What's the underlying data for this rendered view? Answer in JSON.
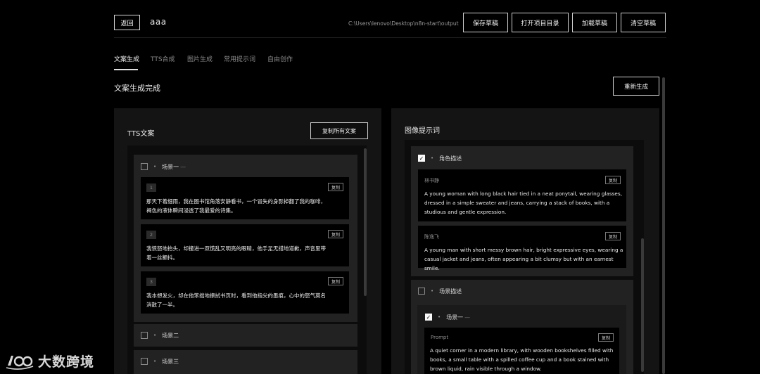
{
  "header": {
    "back_label": "返回",
    "project_name": "aaa",
    "output_path": "C:\\Users\\lenovo\\Desktop\\n8n-start\\output",
    "buttons": [
      "保存草稿",
      "打开项目目录",
      "加载草稿",
      "清空草稿"
    ]
  },
  "tabs": [
    "文案生成",
    "TTS合成",
    "图片生成",
    "常用提示词",
    "自由创作"
  ],
  "main": {
    "title": "文案生成完成",
    "regenerate_label": "重新生成"
  },
  "tts": {
    "title": "TTS文案",
    "copy_all_label": "复制所有文案",
    "scenes": [
      {
        "label": "场景一",
        "checked": false,
        "items": [
          {
            "num": "1",
            "copy_label": "复制",
            "lines": [
              "那天下着细雨，我在图书馆角落安静看书，一个冒失的身影掉翻了我的咖啡，",
              "褐色的液体瞬间浸透了我最爱的诗集。"
            ]
          },
          {
            "num": "2",
            "copy_label": "复制",
            "lines": [
              "我愤怒地抬头，却撞进一双慌乱又明亮的眼睛，他手足无措地道歉，声音里带",
              "着一丝颤抖。"
            ]
          },
          {
            "num": "3",
            "copy_label": "复制",
            "lines": [
              "我本想发火，却在他笨拙地擦拭书页时，看到他指尖的墨痕，心中的怒气莫名",
              "消散了一半。"
            ]
          }
        ]
      },
      {
        "label": "场景二",
        "checked": false
      },
      {
        "label": "场景三",
        "checked": false
      }
    ]
  },
  "image_prompts": {
    "title": "图像提示词",
    "character_section": {
      "label": "角色描述",
      "checked": true,
      "items": [
        {
          "name": "林书静",
          "copy_label": "复制",
          "lines": [
            "A young woman with long black hair tied in a neat ponytail, wearing glasses,",
            "dressed in a simple sweater and jeans, carrying a stack of books, with a",
            "studious and gentle expression."
          ]
        },
        {
          "name": "陈逸飞",
          "copy_label": "复制",
          "lines": [
            "A young man with short messy brown hair, bright expressive eyes, wearing a",
            "casual jacket and jeans, often appearing a bit clumsy but with an earnest smile."
          ]
        }
      ]
    },
    "scene_section": {
      "label": "场景描述",
      "checked": false,
      "scene": {
        "label": "场景一",
        "checked": true,
        "prompt_label": "Prompt",
        "copy_label": "复制",
        "lines": [
          "A quiet corner in a modern library, with wooden bookshelves filled with",
          "books, a small table with a spilled coffee cup and a book stained with",
          "brown liquid, rain visible through a window."
        ]
      }
    }
  },
  "watermark": {
    "text": "大数跨境"
  }
}
